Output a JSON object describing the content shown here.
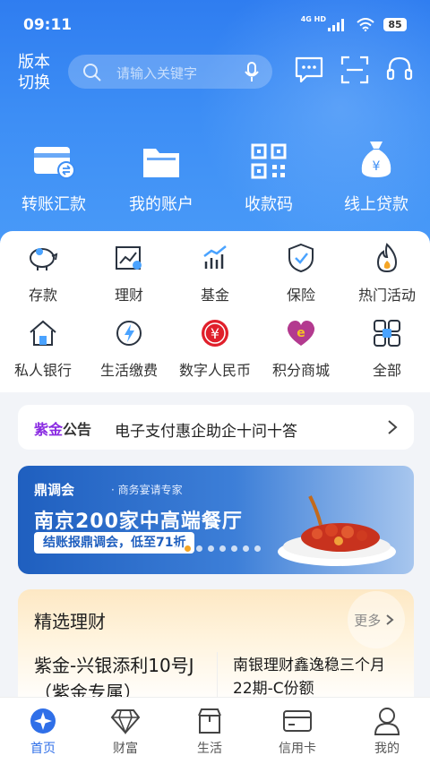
{
  "status": {
    "time": "09:11",
    "network": "4G HD",
    "battery": "85"
  },
  "header": {
    "version_switch": "版本切换",
    "search_placeholder": "请输入关键字"
  },
  "quick_actions": [
    {
      "label": "转账汇款",
      "icon": "transfer-card-icon"
    },
    {
      "label": "我的账户",
      "icon": "folder-icon"
    },
    {
      "label": "收款码",
      "icon": "qr-code-icon"
    },
    {
      "label": "线上贷款",
      "icon": "money-bag-icon"
    }
  ],
  "services": [
    {
      "label": "存款",
      "icon": "piggy-bank-icon"
    },
    {
      "label": "理财",
      "icon": "wealth-chart-icon"
    },
    {
      "label": "基金",
      "icon": "fund-chart-icon"
    },
    {
      "label": "保险",
      "icon": "shield-check-icon"
    },
    {
      "label": "热门活动",
      "icon": "flame-icon"
    },
    {
      "label": "私人银行",
      "icon": "house-icon"
    },
    {
      "label": "生活缴费",
      "icon": "lightning-bill-icon"
    },
    {
      "label": "数字人民币",
      "icon": "digital-rmb-icon"
    },
    {
      "label": "积分商城",
      "icon": "heart-mall-icon"
    },
    {
      "label": "全部",
      "icon": "all-grid-icon"
    }
  ],
  "notice": {
    "tag_a": "紫金",
    "tag_b": "公告",
    "text": "电子支付惠企助企十问十答"
  },
  "banner": {
    "brand": "鼎调会",
    "brand_sub": "· 商务宴请专家",
    "headline": "南京200家中高端餐厅",
    "ribbon": "结账报鼎调会，低至71折",
    "slide_count": 9,
    "active_slide": 3
  },
  "finance": {
    "title": "精选理财",
    "more": "更多",
    "products": [
      "紫金-兴银添利10号J（紫金专属）",
      "南银理财鑫逸稳三个月22期-C份额"
    ]
  },
  "tabs": [
    {
      "label": "首页",
      "icon": "home-star-icon",
      "active": true
    },
    {
      "label": "财富",
      "icon": "diamond-icon",
      "active": false
    },
    {
      "label": "生活",
      "icon": "shop-icon",
      "active": false
    },
    {
      "label": "信用卡",
      "icon": "credit-card-icon",
      "active": false
    },
    {
      "label": "我的",
      "icon": "user-icon",
      "active": false
    }
  ],
  "colors": {
    "primary": "#2f7df0",
    "accent_orange": "#f5a524",
    "tab_active": "#2f6fe8",
    "icon_dark": "#2a3340"
  }
}
